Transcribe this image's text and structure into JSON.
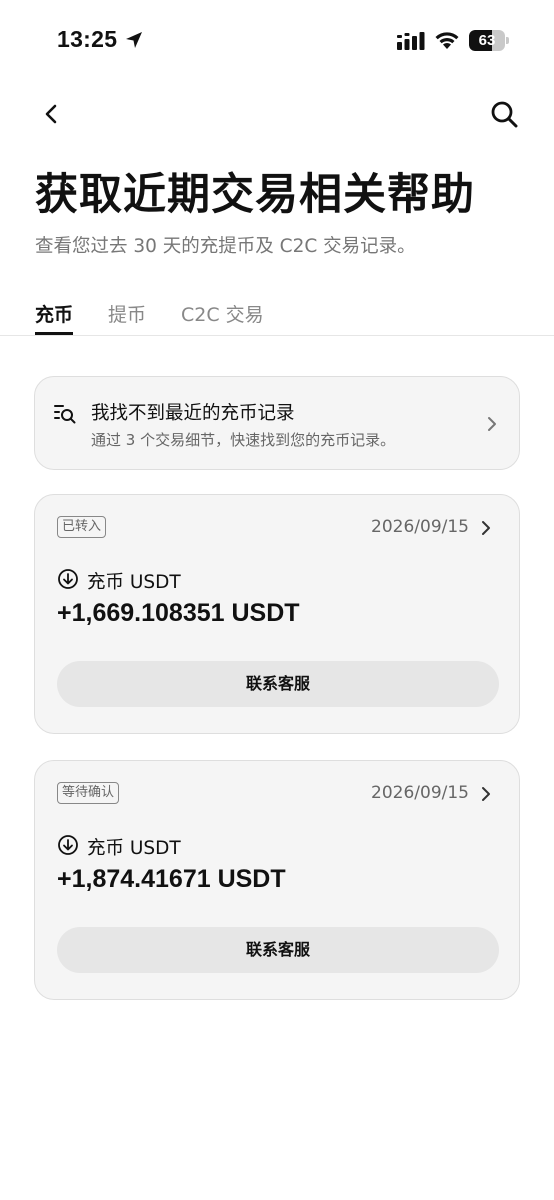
{
  "status_bar": {
    "time": "13:25",
    "battery_level": "63",
    "battery_fraction": 0.63,
    "icons": [
      "location-arrow-icon",
      "signal-icon",
      "wifi-icon",
      "battery-icon"
    ]
  },
  "nav": {
    "back_icon": "chevron-left-icon",
    "search_icon": "search-icon"
  },
  "header": {
    "title": "获取近期交易相关帮助",
    "subtitle": "查看您过去 30 天的充提币及 C2C 交易记录。"
  },
  "tabs": [
    {
      "label": "充币",
      "active": true
    },
    {
      "label": "提币",
      "active": false
    },
    {
      "label": "C2C 交易",
      "active": false
    }
  ],
  "help_card": {
    "icon": "list-search-icon",
    "title": "我找不到最近的充币记录",
    "description": "通过 3 个交易细节，快速找到您的充币记录。"
  },
  "records": [
    {
      "status": "已转入",
      "date": "2026/09/15",
      "type_icon": "deposit-icon",
      "type": "充币 USDT",
      "amount": "+1,669.108351 USDT",
      "button_label": "联系客服"
    },
    {
      "status": "等待确认",
      "date": "2026/09/15",
      "type_icon": "deposit-icon",
      "type": "充币 USDT",
      "amount": "+1,874.41671 USDT",
      "button_label": "联系客服"
    }
  ],
  "colors": {
    "text_primary": "#111111",
    "text_secondary": "#777777",
    "card_bg": "#f5f5f5",
    "card_border": "#dedede",
    "button_bg": "#e6e6e6"
  }
}
